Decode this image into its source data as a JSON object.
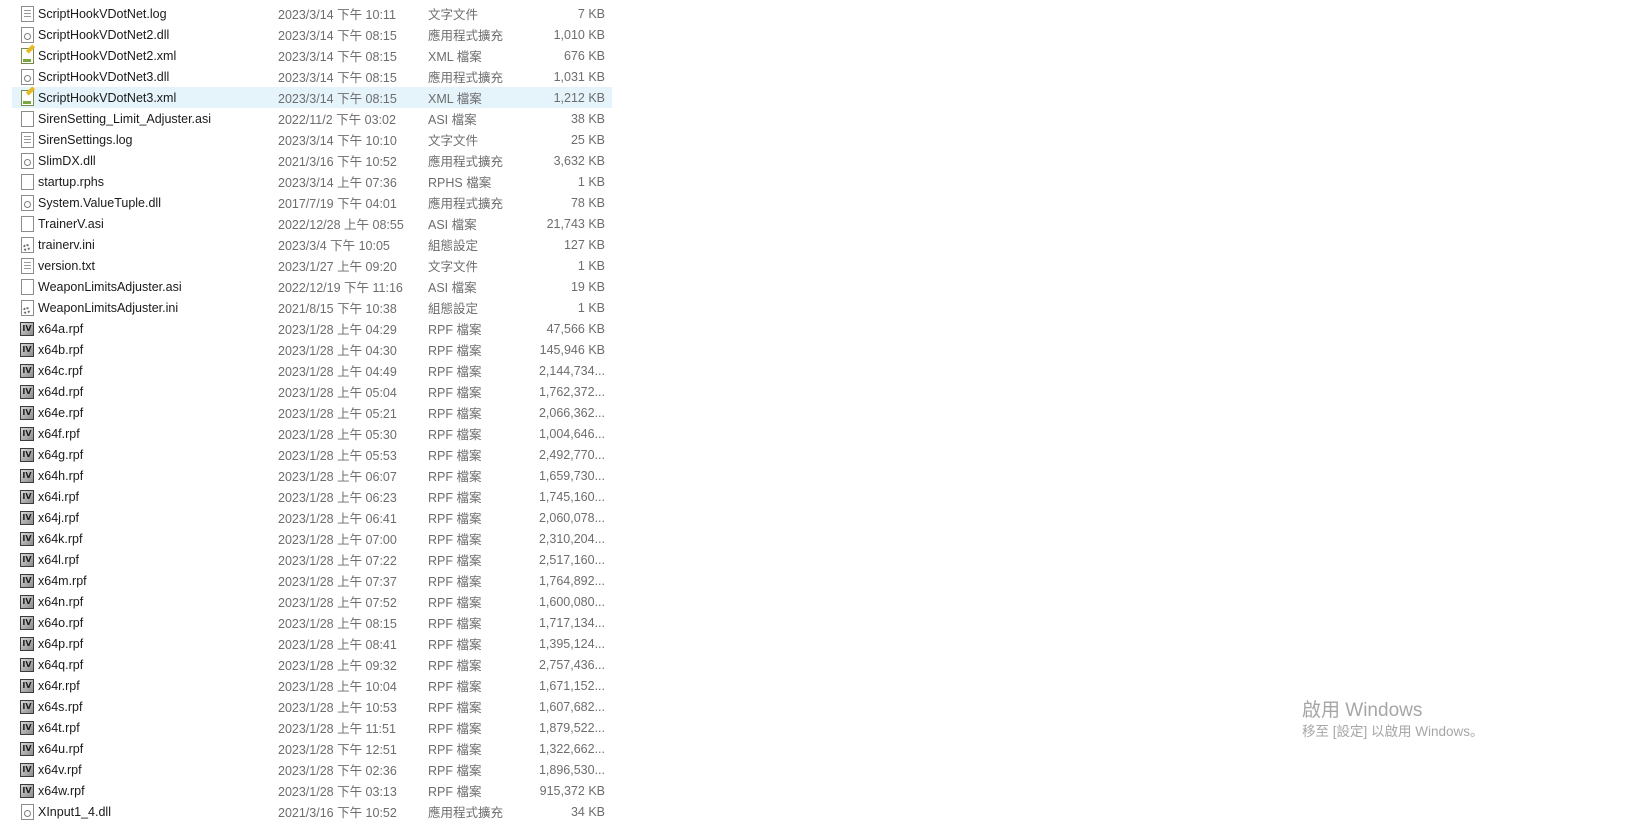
{
  "files": [
    {
      "name": "ScriptHookVDotNet.log",
      "date": "2023/3/14 下午 10:11",
      "type": "文字文件",
      "size": "7 KB",
      "icon": "text-file-icon"
    },
    {
      "name": "ScriptHookVDotNet2.dll",
      "date": "2023/3/14 下午 08:15",
      "type": "應用程式擴充",
      "size": "1,010 KB",
      "icon": "dll-file-icon"
    },
    {
      "name": "ScriptHookVDotNet2.xml",
      "date": "2023/3/14 下午 08:15",
      "type": "XML 檔案",
      "size": "676 KB",
      "icon": "xml-file-icon"
    },
    {
      "name": "ScriptHookVDotNet3.dll",
      "date": "2023/3/14 下午 08:15",
      "type": "應用程式擴充",
      "size": "1,031 KB",
      "icon": "dll-file-icon"
    },
    {
      "name": "ScriptHookVDotNet3.xml",
      "date": "2023/3/14 下午 08:15",
      "type": "XML 檔案",
      "size": "1,212 KB",
      "icon": "xml-file-icon",
      "selected": true
    },
    {
      "name": "SirenSetting_Limit_Adjuster.asi",
      "date": "2022/11/2 下午 03:02",
      "type": "ASI 檔案",
      "size": "38 KB",
      "icon": "blank-file-icon"
    },
    {
      "name": "SirenSettings.log",
      "date": "2023/3/14 下午 10:10",
      "type": "文字文件",
      "size": "25 KB",
      "icon": "text-file-icon"
    },
    {
      "name": "SlimDX.dll",
      "date": "2021/3/16 下午 10:52",
      "type": "應用程式擴充",
      "size": "3,632 KB",
      "icon": "dll-file-icon"
    },
    {
      "name": "startup.rphs",
      "date": "2023/3/14 上午 07:36",
      "type": "RPHS 檔案",
      "size": "1 KB",
      "icon": "blank-file-icon"
    },
    {
      "name": "System.ValueTuple.dll",
      "date": "2017/7/19 下午 04:01",
      "type": "應用程式擴充",
      "size": "78 KB",
      "icon": "dll-file-icon"
    },
    {
      "name": "TrainerV.asi",
      "date": "2022/12/28 上午 08:55",
      "type": "ASI 檔案",
      "size": "21,743 KB",
      "icon": "blank-file-icon"
    },
    {
      "name": "trainerv.ini",
      "date": "2023/3/4 下午 10:05",
      "type": "組態設定",
      "size": "127 KB",
      "icon": "ini-file-icon"
    },
    {
      "name": "version.txt",
      "date": "2023/1/27 上午 09:20",
      "type": "文字文件",
      "size": "1 KB",
      "icon": "text-file-icon"
    },
    {
      "name": "WeaponLimitsAdjuster.asi",
      "date": "2022/12/19 下午 11:16",
      "type": "ASI 檔案",
      "size": "19 KB",
      "icon": "blank-file-icon"
    },
    {
      "name": "WeaponLimitsAdjuster.ini",
      "date": "2021/8/15 下午 10:38",
      "type": "組態設定",
      "size": "1 KB",
      "icon": "ini-file-icon"
    },
    {
      "name": "x64a.rpf",
      "date": "2023/1/28 上午 04:29",
      "type": "RPF 檔案",
      "size": "47,566 KB",
      "icon": "rpf-file-icon"
    },
    {
      "name": "x64b.rpf",
      "date": "2023/1/28 上午 04:30",
      "type": "RPF 檔案",
      "size": "145,946 KB",
      "icon": "rpf-file-icon"
    },
    {
      "name": "x64c.rpf",
      "date": "2023/1/28 上午 04:49",
      "type": "RPF 檔案",
      "size": "2,144,734...",
      "icon": "rpf-file-icon"
    },
    {
      "name": "x64d.rpf",
      "date": "2023/1/28 上午 05:04",
      "type": "RPF 檔案",
      "size": "1,762,372...",
      "icon": "rpf-file-icon"
    },
    {
      "name": "x64e.rpf",
      "date": "2023/1/28 上午 05:21",
      "type": "RPF 檔案",
      "size": "2,066,362...",
      "icon": "rpf-file-icon"
    },
    {
      "name": "x64f.rpf",
      "date": "2023/1/28 上午 05:30",
      "type": "RPF 檔案",
      "size": "1,004,646...",
      "icon": "rpf-file-icon"
    },
    {
      "name": "x64g.rpf",
      "date": "2023/1/28 上午 05:53",
      "type": "RPF 檔案",
      "size": "2,492,770...",
      "icon": "rpf-file-icon"
    },
    {
      "name": "x64h.rpf",
      "date": "2023/1/28 上午 06:07",
      "type": "RPF 檔案",
      "size": "1,659,730...",
      "icon": "rpf-file-icon"
    },
    {
      "name": "x64i.rpf",
      "date": "2023/1/28 上午 06:23",
      "type": "RPF 檔案",
      "size": "1,745,160...",
      "icon": "rpf-file-icon"
    },
    {
      "name": "x64j.rpf",
      "date": "2023/1/28 上午 06:41",
      "type": "RPF 檔案",
      "size": "2,060,078...",
      "icon": "rpf-file-icon"
    },
    {
      "name": "x64k.rpf",
      "date": "2023/1/28 上午 07:00",
      "type": "RPF 檔案",
      "size": "2,310,204...",
      "icon": "rpf-file-icon"
    },
    {
      "name": "x64l.rpf",
      "date": "2023/1/28 上午 07:22",
      "type": "RPF 檔案",
      "size": "2,517,160...",
      "icon": "rpf-file-icon"
    },
    {
      "name": "x64m.rpf",
      "date": "2023/1/28 上午 07:37",
      "type": "RPF 檔案",
      "size": "1,764,892...",
      "icon": "rpf-file-icon"
    },
    {
      "name": "x64n.rpf",
      "date": "2023/1/28 上午 07:52",
      "type": "RPF 檔案",
      "size": "1,600,080...",
      "icon": "rpf-file-icon"
    },
    {
      "name": "x64o.rpf",
      "date": "2023/1/28 上午 08:15",
      "type": "RPF 檔案",
      "size": "1,717,134...",
      "icon": "rpf-file-icon"
    },
    {
      "name": "x64p.rpf",
      "date": "2023/1/28 上午 08:41",
      "type": "RPF 檔案",
      "size": "1,395,124...",
      "icon": "rpf-file-icon"
    },
    {
      "name": "x64q.rpf",
      "date": "2023/1/28 上午 09:32",
      "type": "RPF 檔案",
      "size": "2,757,436...",
      "icon": "rpf-file-icon"
    },
    {
      "name": "x64r.rpf",
      "date": "2023/1/28 上午 10:04",
      "type": "RPF 檔案",
      "size": "1,671,152...",
      "icon": "rpf-file-icon"
    },
    {
      "name": "x64s.rpf",
      "date": "2023/1/28 上午 10:53",
      "type": "RPF 檔案",
      "size": "1,607,682...",
      "icon": "rpf-file-icon"
    },
    {
      "name": "x64t.rpf",
      "date": "2023/1/28 上午 11:51",
      "type": "RPF 檔案",
      "size": "1,879,522...",
      "icon": "rpf-file-icon"
    },
    {
      "name": "x64u.rpf",
      "date": "2023/1/28 下午 12:51",
      "type": "RPF 檔案",
      "size": "1,322,662...",
      "icon": "rpf-file-icon"
    },
    {
      "name": "x64v.rpf",
      "date": "2023/1/28 下午 02:36",
      "type": "RPF 檔案",
      "size": "1,896,530...",
      "icon": "rpf-file-icon"
    },
    {
      "name": "x64w.rpf",
      "date": "2023/1/28 下午 03:13",
      "type": "RPF 檔案",
      "size": "915,372 KB",
      "icon": "rpf-file-icon"
    },
    {
      "name": "XInput1_4.dll",
      "date": "2021/3/16 下午 10:52",
      "type": "應用程式擴充",
      "size": "34 KB",
      "icon": "dll-file-icon"
    }
  ],
  "rpf_icon_glyph": "IV",
  "selection_color": "#e5f3fb",
  "watermark": {
    "title": "啟用 Windows",
    "subtitle": "移至 [設定] 以啟用 Windows。"
  }
}
